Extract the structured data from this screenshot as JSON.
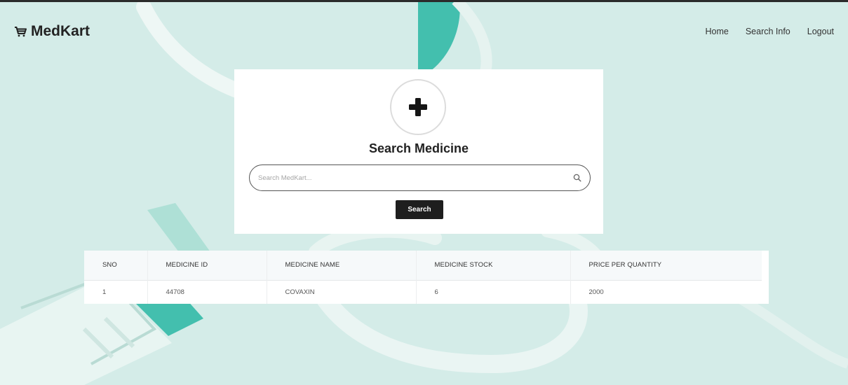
{
  "brand": {
    "name": "MedKart",
    "icon": "cart-icon"
  },
  "nav": {
    "home": "Home",
    "search_info": "Search Info",
    "logout": "Logout"
  },
  "search_card": {
    "icon": "plus-icon",
    "title": "Search Medicine",
    "placeholder": "Search MedKart...",
    "value": "",
    "button_label": "Search"
  },
  "table": {
    "headers": [
      "SNO",
      "MEDICINE ID",
      "MEDICINE NAME",
      "MEDICINE STOCK",
      "PRICE PER QUANTITY"
    ],
    "rows": [
      [
        "1",
        "44708",
        "COVAXIN",
        "6",
        "2000"
      ]
    ]
  },
  "colors": {
    "background": "#d3ebe7",
    "accent": "#3cbfad",
    "dark": "#1e1e1e"
  }
}
